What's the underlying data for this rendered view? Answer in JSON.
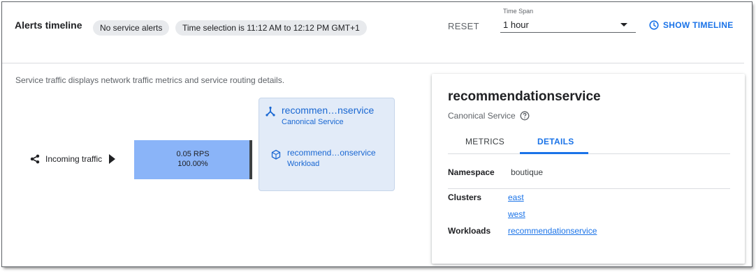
{
  "alerts": {
    "title": "Alerts timeline",
    "chip_no_alerts": "No service alerts",
    "chip_time_selection": "Time selection is 11:12 AM to 12:12 PM GMT+1",
    "reset_label": "RESET",
    "time_span_label": "Time Span",
    "time_span_value": "1 hour",
    "show_timeline_label": "SHOW TIMELINE"
  },
  "graph": {
    "description": "Service traffic displays network traffic metrics and service routing details.",
    "incoming_label": "Incoming traffic",
    "rps": "0.05 RPS",
    "percent": "100.00%",
    "service": {
      "name": "recommen…nservice",
      "type": "Canonical Service"
    },
    "workload": {
      "name": "recommend…onservice",
      "type": "Workload"
    }
  },
  "panel": {
    "title": "recommendationservice",
    "subtitle": "Canonical Service",
    "tabs": [
      {
        "label": "METRICS"
      },
      {
        "label": "DETAILS"
      }
    ],
    "namespace_key": "Namespace",
    "namespace_value": "boutique",
    "clusters_key": "Clusters",
    "clusters": [
      "east",
      "west"
    ],
    "workloads_key": "Workloads",
    "workloads": [
      "recommendationservice"
    ]
  },
  "colors": {
    "accent": "#1a73e8",
    "traffic_bar": "#8ab4f8",
    "service_card": "#e2ebf8"
  }
}
